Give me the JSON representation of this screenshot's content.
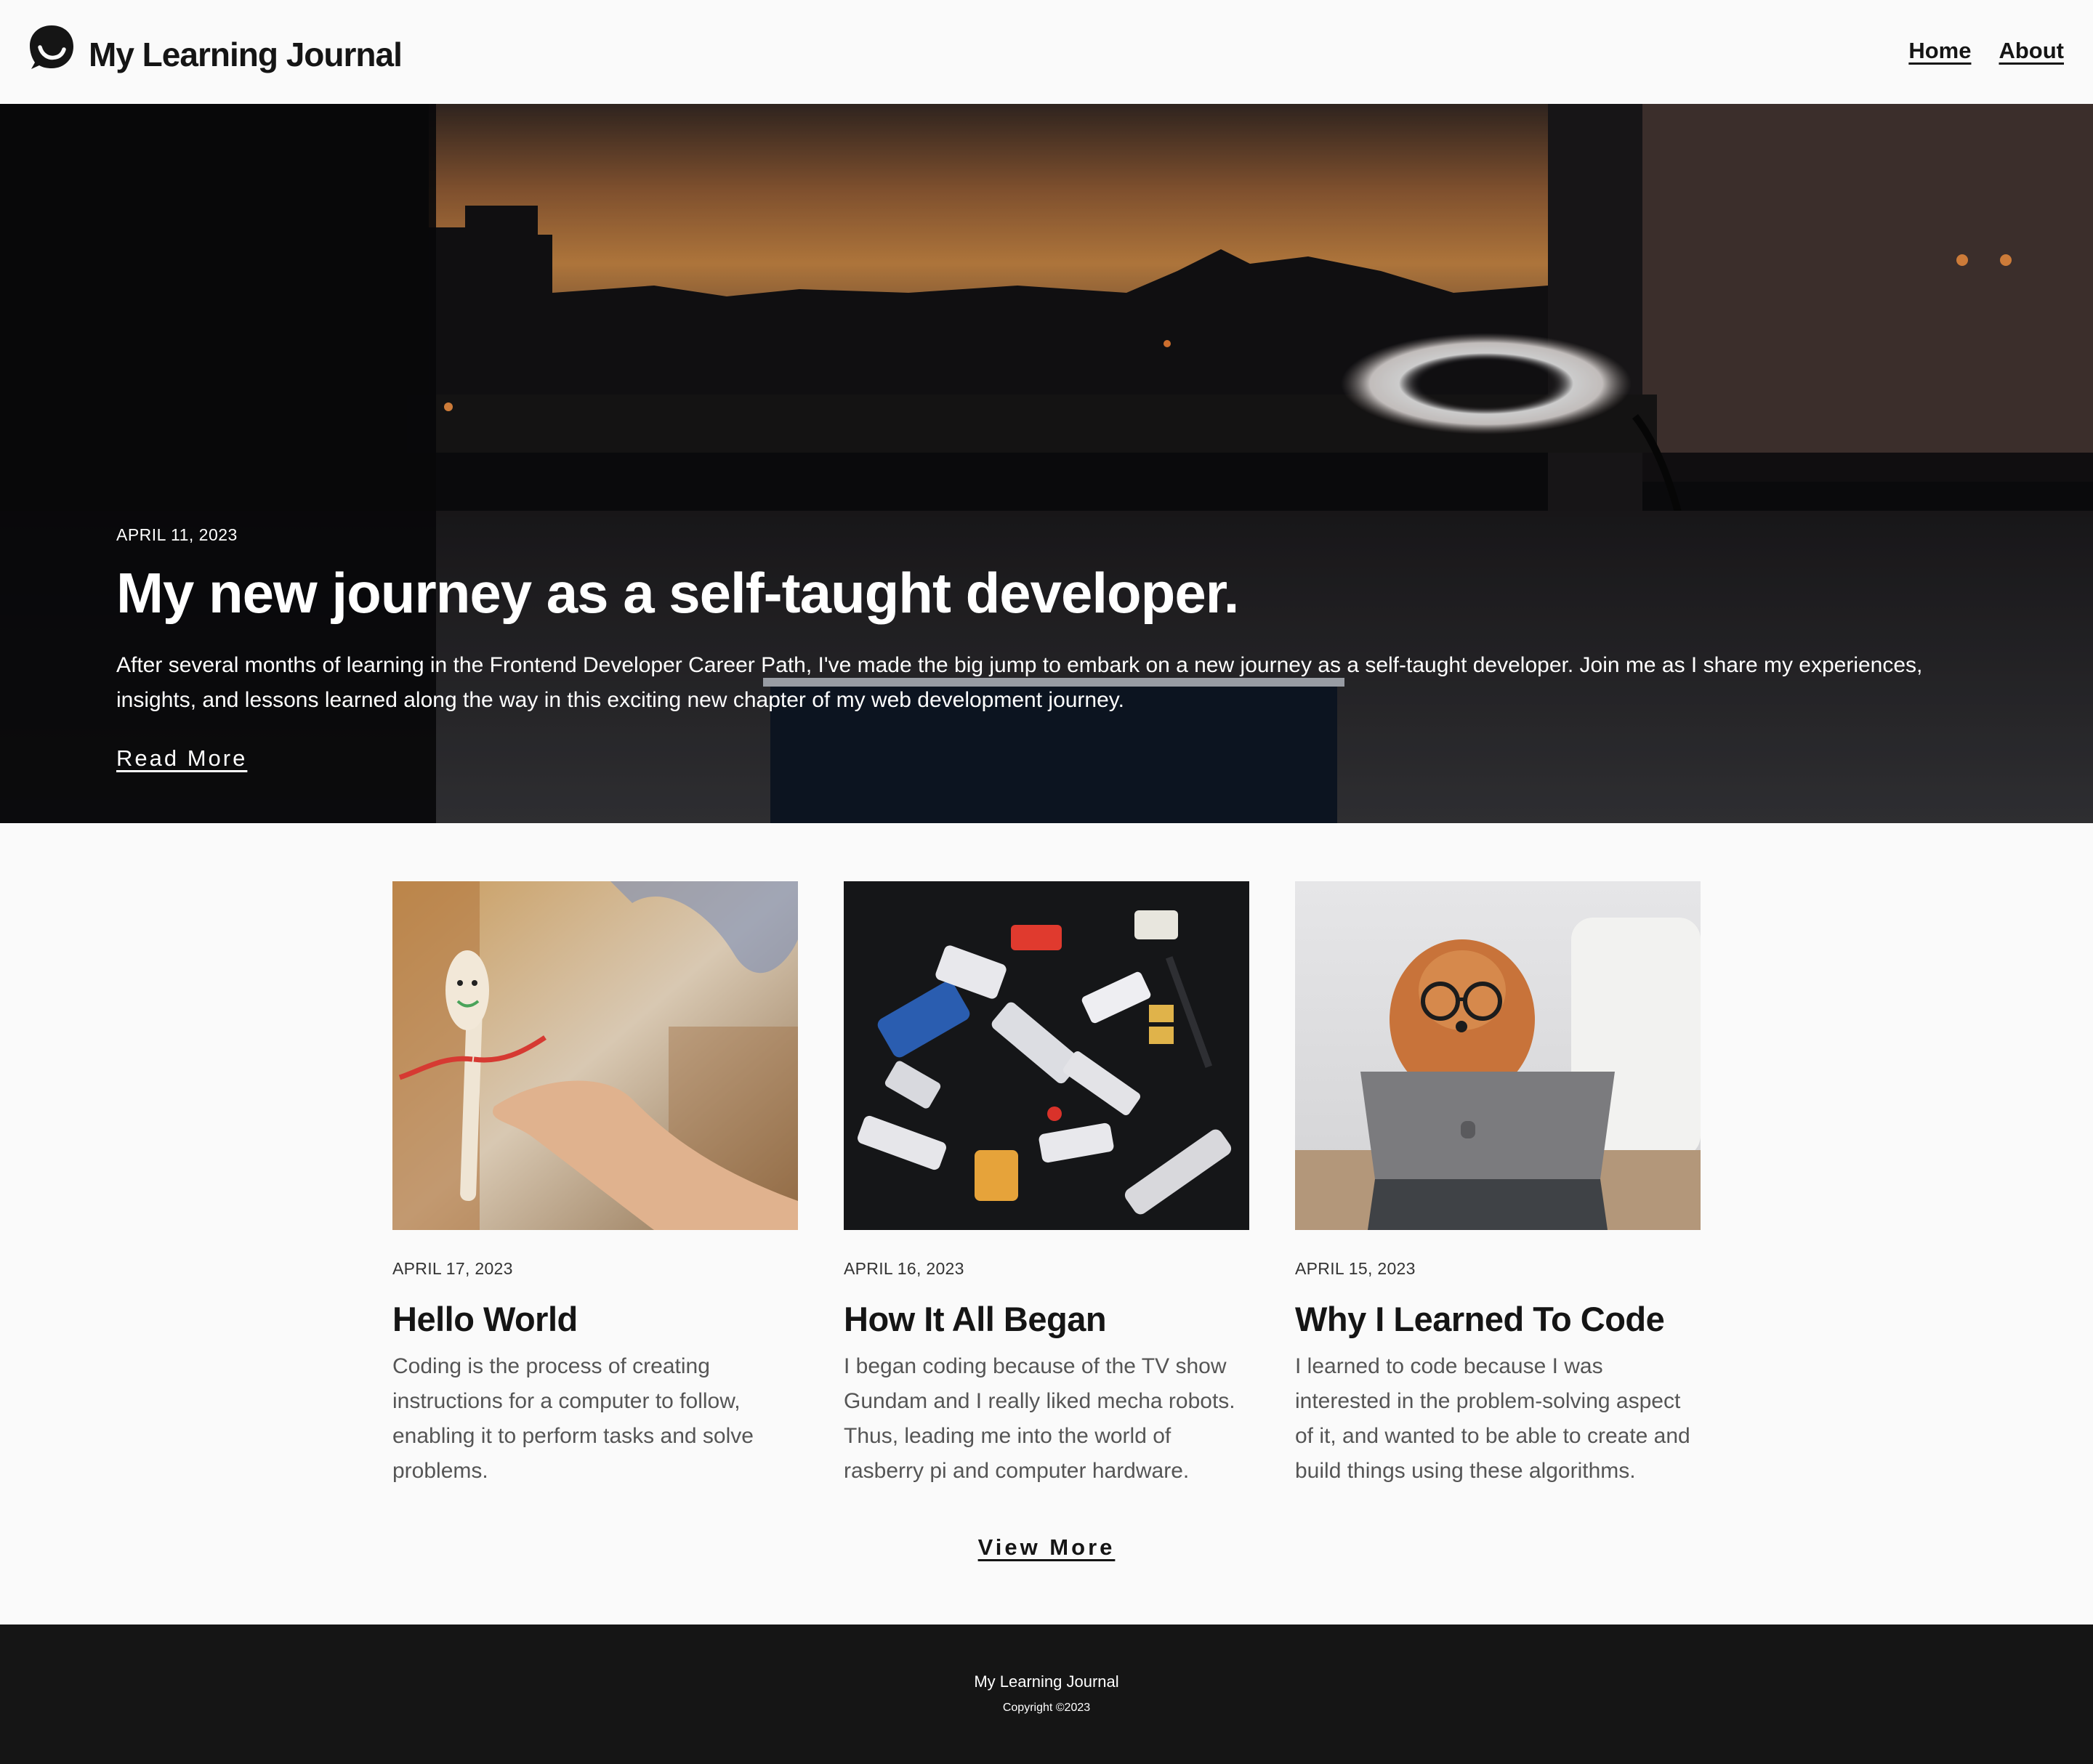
{
  "header": {
    "logo_icon": "smiley-chat-bubble-icon",
    "title": "My Learning Journal",
    "nav": [
      {
        "label": "Home"
      },
      {
        "label": "About"
      }
    ]
  },
  "hero": {
    "date": "APRIL 11, 2023",
    "title": "My new journey as a self-taught developer.",
    "text": "After several months of learning in the Frontend Developer Career Path, I've made the big jump to embark on a new journey as a self-taught developer. Join me as I share my experiences, insights, and lessons learned along the way in this exciting new chapter of my web development journey.",
    "link_label": "Read More"
  },
  "posts": [
    {
      "date": "APRIL 17, 2023",
      "title": "Hello World",
      "excerpt": "Coding is the process of creating instructions for a computer to follow, enabling it to perform tasks and solve problems."
    },
    {
      "date": "APRIL 16, 2023",
      "title": "How It All Began",
      "excerpt": "I began coding because of the TV show Gundam and I really liked mecha robots. Thus, leading me into the world of rasberry pi and computer hardware."
    },
    {
      "date": "APRIL 15, 2023",
      "title": "Why I Learned To Code",
      "excerpt": "I learned to code because I was interested in the problem-solving aspect of it, and wanted to be able to create and build things using these algorithms."
    }
  ],
  "view_more_label": "View More",
  "footer": {
    "title": "My Learning Journal",
    "copyright": "Copyright ©2023"
  },
  "colors": {
    "page_bg": "#fafafa",
    "text": "#151515",
    "footer_bg": "#151515",
    "excerpt": "#555555"
  }
}
